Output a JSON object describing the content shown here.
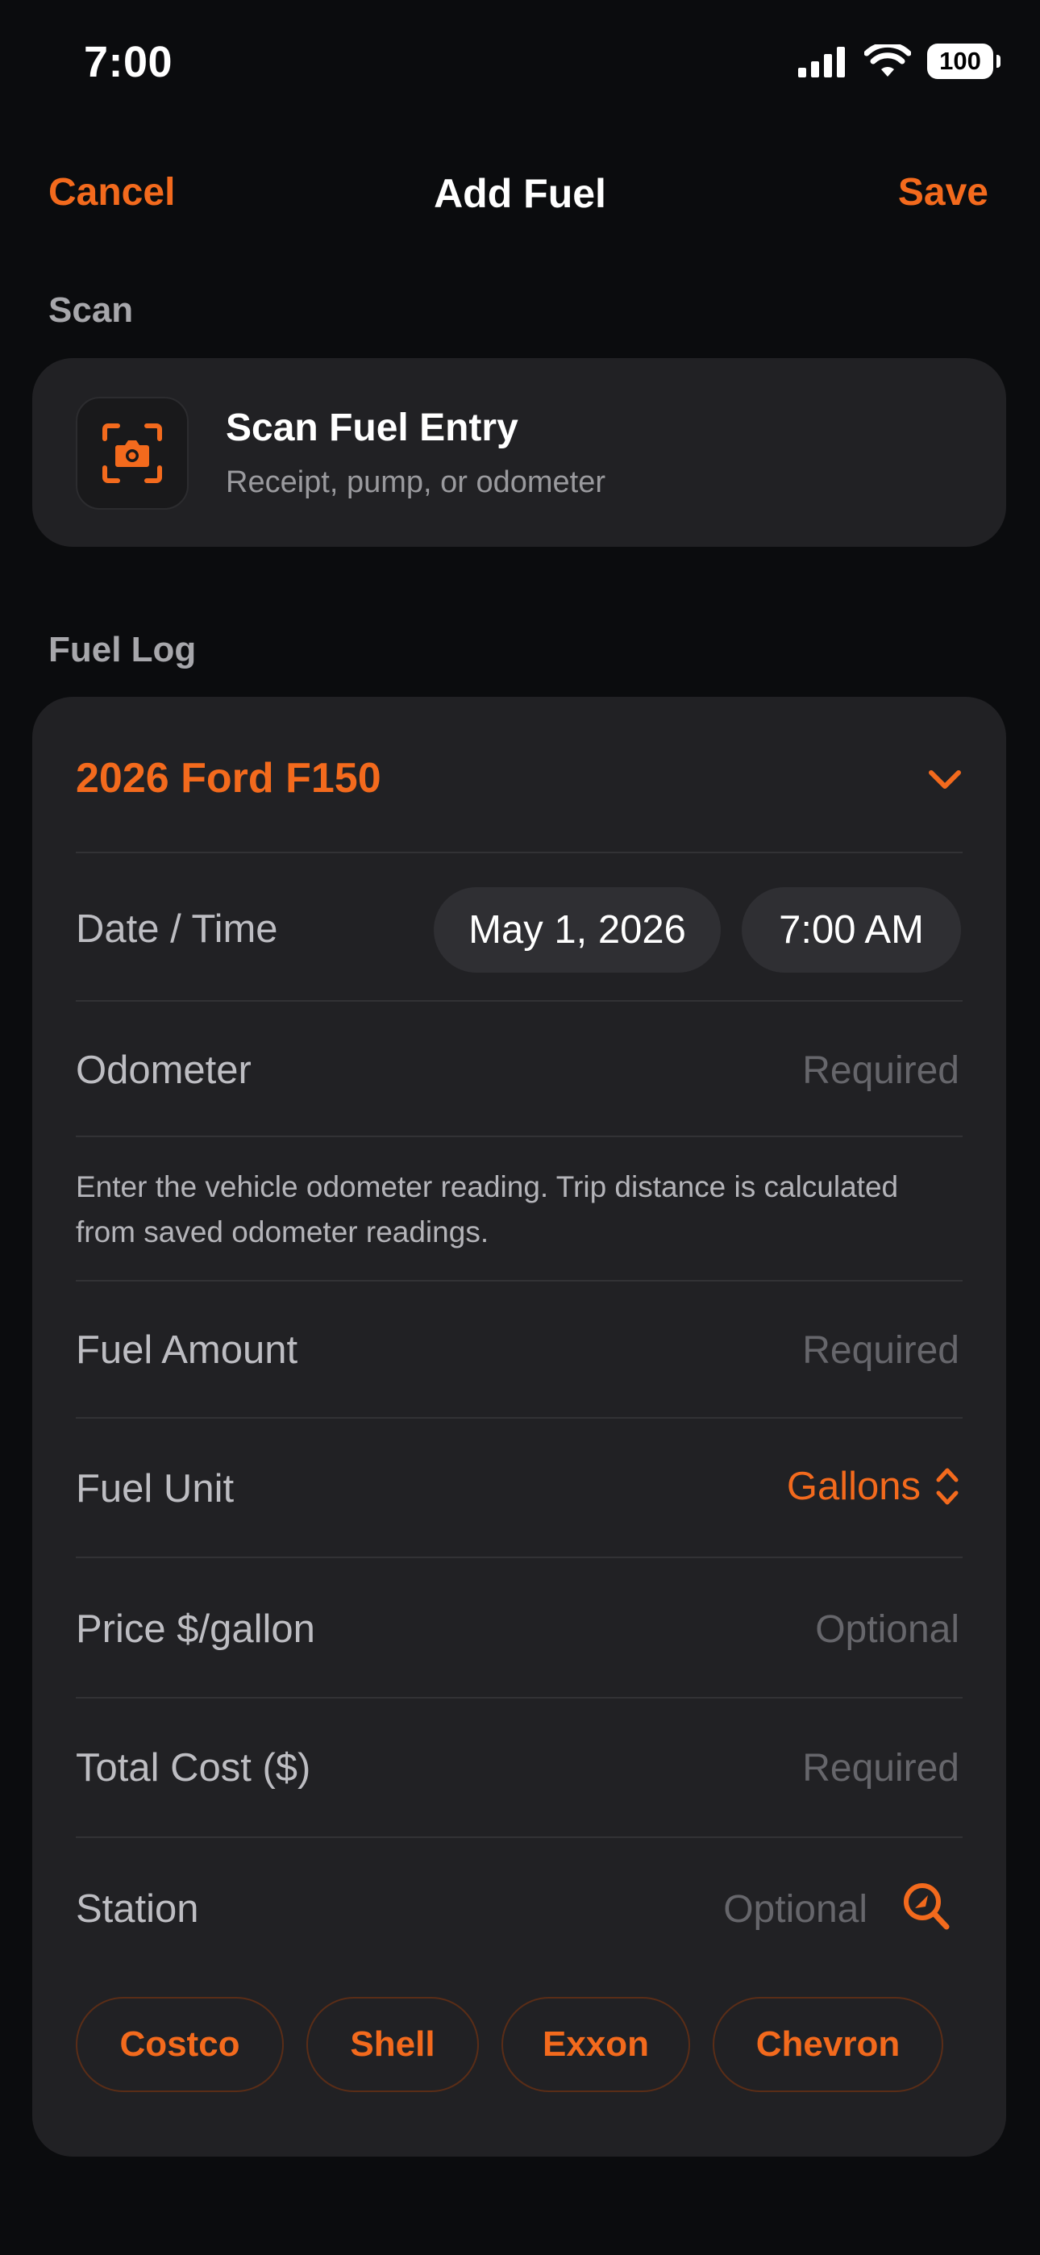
{
  "status_bar": {
    "time": "7:00",
    "battery": "100",
    "icons": [
      "cellular-signal-icon",
      "wifi-icon",
      "battery-icon"
    ]
  },
  "nav": {
    "cancel_label": "Cancel",
    "title": "Add Fuel",
    "save_label": "Save"
  },
  "scan_section": {
    "header": "Scan",
    "card_title": "Scan Fuel Entry",
    "card_subtitle": "Receipt, pump, or odometer",
    "icon": "camera-scan-icon"
  },
  "fuel_log": {
    "header": "Fuel Log",
    "vehicle": "2026 Ford F150",
    "date_time": {
      "label": "Date / Time",
      "date": "May 1, 2026",
      "time": "7:00 AM"
    },
    "odometer": {
      "label": "Odometer",
      "placeholder": "Required",
      "hint": "Enter the vehicle odometer reading. Trip distance is calculated from saved odometer readings."
    },
    "fuel_amount": {
      "label": "Fuel Amount",
      "placeholder": "Required"
    },
    "fuel_unit": {
      "label": "Fuel Unit",
      "value": "Gallons"
    },
    "price": {
      "label": "Price $/gallon",
      "placeholder": "Optional"
    },
    "total_cost": {
      "label": "Total Cost ($)",
      "placeholder": "Required"
    },
    "station": {
      "label": "Station",
      "placeholder": "Optional",
      "suggestions": [
        "Costco",
        "Shell",
        "Exxon",
        "Chevron"
      ]
    }
  },
  "colors": {
    "accent": "#f36a1d",
    "background": "#0b0c0e",
    "card": "#212124",
    "placeholder": "#66666b"
  }
}
